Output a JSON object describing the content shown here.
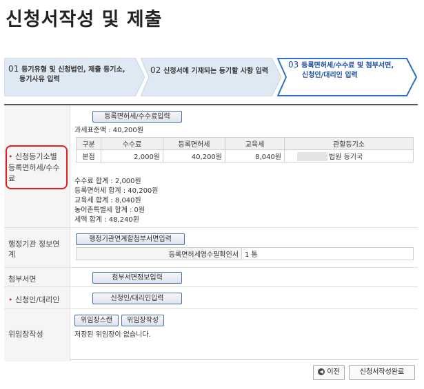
{
  "page_title": "신청서작성 및 제출",
  "steps": [
    {
      "num": "01",
      "line1": "등기유형 및 신청법인, 제출 등기소,",
      "line2": "등기사유 입력"
    },
    {
      "num": "02",
      "line1": "신청서에 기재되는 등기할 사항 입력",
      "line2": ""
    },
    {
      "num": "03",
      "line1": "등록면허세/수수료 및 첨부서면,",
      "line2": "신청인/대리인 입력"
    }
  ],
  "fee_row": {
    "label": "신청등기소별 등록면허세/수수료",
    "button": "등록면허세/수수료입력",
    "tax_base": "과세표준액 : 40,200원",
    "table": {
      "headers": [
        "구분",
        "수수료",
        "등록면허세",
        "교육세",
        "관할등기소"
      ],
      "rows": [
        [
          "본점",
          "2,000원",
          "40,200원",
          "8,040원",
          "법원 등기국"
        ]
      ]
    },
    "summary": [
      "수수료 합계 : 2,000원",
      "등록면허세 합계 : 40,200원",
      "교육세 합계 : 8,040원",
      "농어촌특별세 합계 : 0원",
      "세액 합계 : 48,240원"
    ]
  },
  "admin_row": {
    "label": "행정기관 정보연계",
    "button": "행정기관연계할첨부서면입력",
    "doc_name": "등록면허세영수필확인서",
    "doc_count": "1 통"
  },
  "attach_row": {
    "label": "첨부서면",
    "button": "첨부서면정보입력"
  },
  "applicant_row": {
    "label": "신청인/대리인",
    "button": "신청인/대리인입력"
  },
  "delegate_row": {
    "label": "위임장작성",
    "scan_button": "위임장스캔",
    "write_button": "위임장작성",
    "message": "저장된 위임장이 없습니다."
  },
  "footer": {
    "prev": "이전",
    "complete": "신청서작성완료"
  },
  "colors": {
    "required": "#d9302a",
    "highlight": "#e31d1d",
    "active_step": "#1a4fa0"
  }
}
